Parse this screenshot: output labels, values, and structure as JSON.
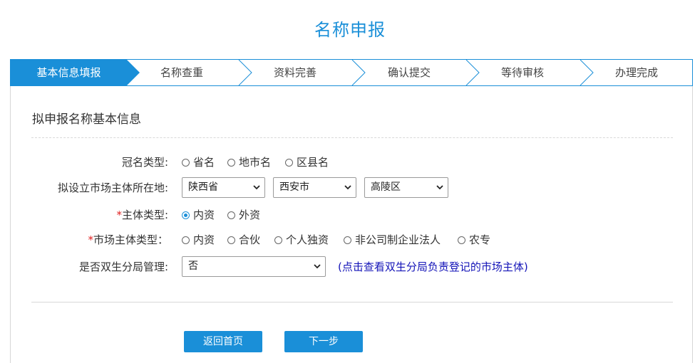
{
  "page_title": "名称申报",
  "steps": [
    {
      "label": "基本信息填报",
      "active": true
    },
    {
      "label": "名称查重",
      "active": false
    },
    {
      "label": "资料完善",
      "active": false
    },
    {
      "label": "确认提交",
      "active": false
    },
    {
      "label": "等待审核",
      "active": false
    },
    {
      "label": "办理完成",
      "active": false
    }
  ],
  "section_title": "拟申报名称基本信息",
  "form": {
    "crown_type": {
      "label": "冠名类型:",
      "options": [
        "省名",
        "地市名",
        "区县名"
      ],
      "selected": null
    },
    "location": {
      "label": "拟设立市场主体所在地:",
      "province": "陕西省",
      "city": "西安市",
      "district": "高陵区"
    },
    "entity_type": {
      "required_mark": "*",
      "label": "主体类型:",
      "options": [
        "内资",
        "外资"
      ],
      "selected": "内资"
    },
    "market_entity_type": {
      "required_mark": "*",
      "label": "市场主体类型：",
      "options": [
        "内资",
        "合伙",
        "个人独资",
        "非公司制企业法人",
        "农专"
      ],
      "selected": null
    },
    "dual_branch": {
      "label": "是否双生分局管理:",
      "value": "否",
      "link_text": "(点击查看双生分局负责登记的市场主体)"
    }
  },
  "buttons": {
    "back_label": "返回首页",
    "next_label": "下一步"
  },
  "colors": {
    "accent": "#1a8fd8",
    "required": "#e02020",
    "link": "#1414b8"
  }
}
